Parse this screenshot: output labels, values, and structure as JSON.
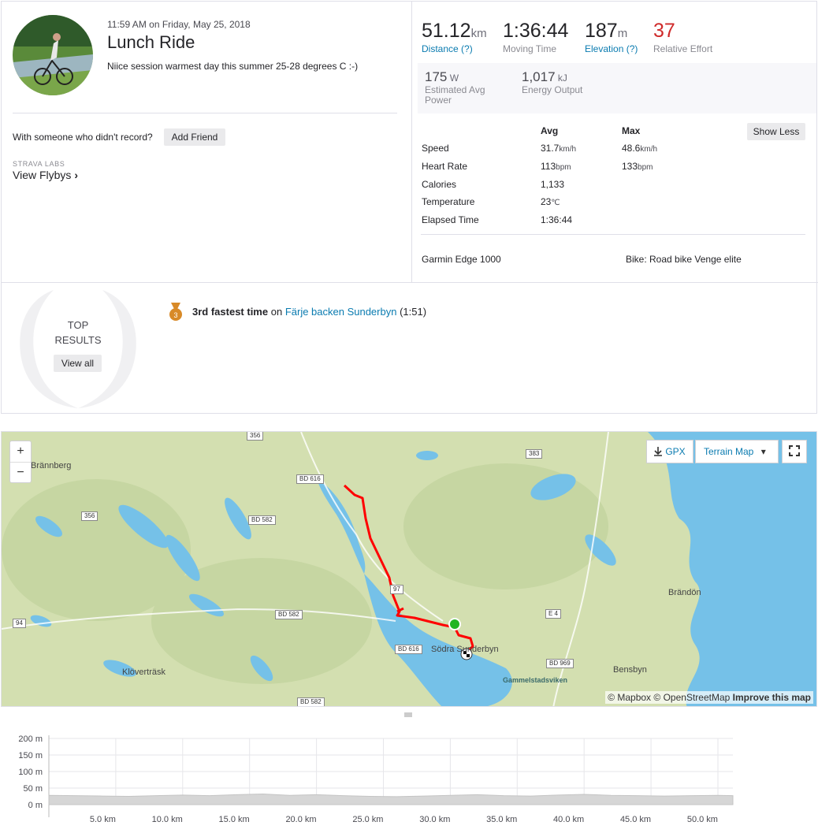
{
  "activity": {
    "datetime": "11:59 AM on Friday, May 25, 2018",
    "title": "Lunch Ride",
    "description": "Niice session warmest day this summer 25-28 degrees C :-)",
    "with_someone": "With someone who didn't record?",
    "add_friend": "Add Friend",
    "labs": "STRAVA LABS",
    "view_flybys": "View Flybys"
  },
  "stats": {
    "distance": {
      "value": "51.12",
      "unit": "km",
      "label": "Distance (?)"
    },
    "moving_time": {
      "value": "1:36:44",
      "label": "Moving Time"
    },
    "elevation": {
      "value": "187",
      "unit": "m",
      "label": "Elevation (?)"
    },
    "relative_effort": {
      "value": "37",
      "label": "Relative Effort",
      "color": "#cf2a2a"
    },
    "power": {
      "value": "175",
      "unit": "W",
      "label": "Estimated Avg Power"
    },
    "energy": {
      "value": "1,017",
      "unit": "kJ",
      "label": "Energy Output"
    }
  },
  "details": {
    "avg_header": "Avg",
    "max_header": "Max",
    "show_less": "Show Less",
    "rows": [
      {
        "label": "Speed",
        "avg": "31.7",
        "avg_unit": "km/h",
        "max": "48.6",
        "max_unit": "km/h"
      },
      {
        "label": "Heart Rate",
        "avg": "113",
        "avg_unit": "bpm",
        "max": "133",
        "max_unit": "bpm"
      },
      {
        "label": "Calories",
        "avg": "1,133",
        "avg_unit": "",
        "max": "",
        "max_unit": ""
      },
      {
        "label": "Temperature",
        "avg": "23",
        "avg_unit": "℃",
        "max": "",
        "max_unit": ""
      },
      {
        "label": "Elapsed Time",
        "avg": "1:36:44",
        "avg_unit": "",
        "max": "",
        "max_unit": ""
      }
    ],
    "device": "Garmin Edge 1000",
    "bike": "Bike: Road bike Venge elite"
  },
  "results": {
    "top_line1": "TOP",
    "top_line2": "RESULTS",
    "view_all": "View all",
    "medal_rank": "3",
    "achievement_bold": "3rd fastest time",
    "achievement_on": "on",
    "segment": "Färje backen Sunderbyn",
    "segment_time": "(1:51)",
    "medal_color": "#d88a28"
  },
  "map": {
    "zoom_in": "+",
    "zoom_out": "−",
    "gpx": "GPX",
    "terrain": "Terrain Map",
    "attribution_mapbox": "© Mapbox",
    "attribution_osm": "© OpenStreetMap",
    "improve": "Improve this map",
    "labels": {
      "brannberg": "Brännberg",
      "klovertrask": "Klöverträsk",
      "sodra_sunderbyn": "Södra Sunderbyn",
      "brandon": "Brändön",
      "bensbyn": "Bensbyn",
      "gammelstadsviken": "Gammelstadsviken"
    },
    "roads": [
      "356",
      "383",
      "BD 616",
      "356",
      "BD 582",
      "97",
      "94",
      "BD 582",
      "E 4",
      "BD 616",
      "BD 969",
      "BD 582"
    ],
    "route_color": "#ff0000",
    "water_color": "#75c1e8",
    "land_color": "#d3dfb0"
  },
  "elevation_chart": {
    "type": "area",
    "ylabels": [
      "200 m",
      "150 m",
      "100 m",
      "50 m",
      "0 m"
    ],
    "xlabels": [
      "5.0 km",
      "10.0 km",
      "15.0 km",
      "20.0 km",
      "25.0 km",
      "30.0 km",
      "35.0 km",
      "40.0 km",
      "45.0 km",
      "50.0 km"
    ],
    "ylim": [
      0,
      200
    ],
    "xlim": [
      0,
      51.12
    ],
    "x": [
      0,
      2,
      4,
      6,
      8,
      10,
      12,
      14,
      16,
      18,
      20,
      22,
      24,
      26,
      28,
      30,
      32,
      34,
      36,
      38,
      40,
      42,
      44,
      46,
      48,
      50,
      51.12
    ],
    "y": [
      28,
      27,
      26,
      25,
      27,
      29,
      27,
      30,
      32,
      28,
      30,
      27,
      25,
      24,
      26,
      28,
      30,
      27,
      26,
      29,
      31,
      28,
      27,
      26,
      27,
      28,
      27
    ],
    "fill": "#d6d6d6"
  }
}
